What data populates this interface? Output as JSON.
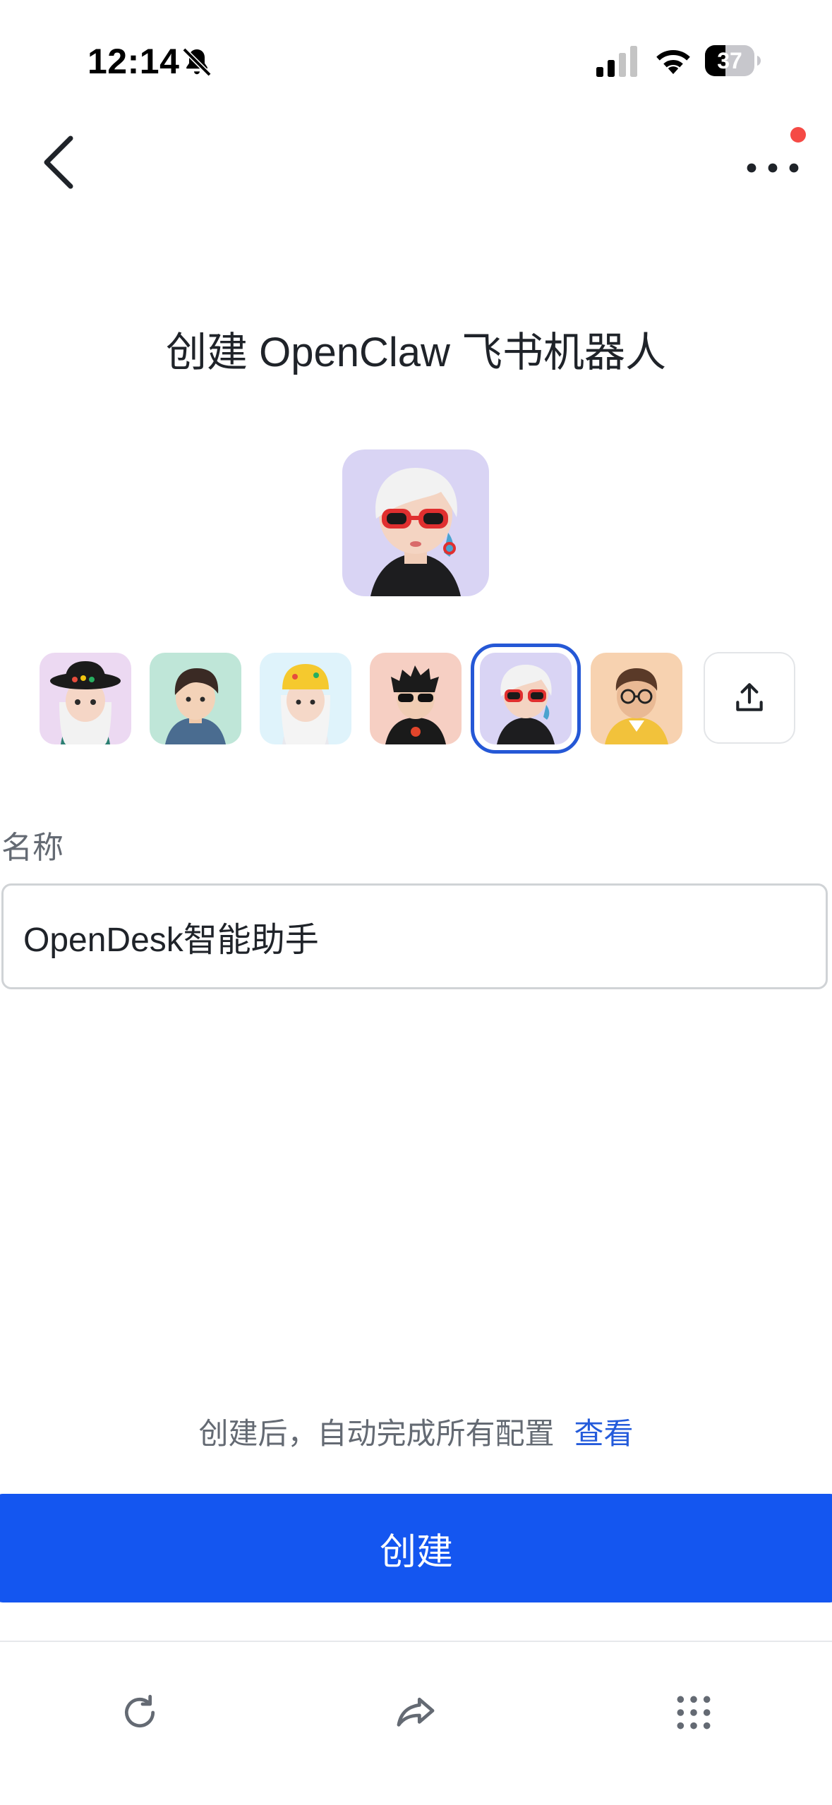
{
  "status_bar": {
    "time": "12:14",
    "battery": "37",
    "icons": [
      "bell-muted-icon",
      "cellular-signal-icon",
      "wifi-icon",
      "battery-icon"
    ]
  },
  "nav": {
    "back_icon": "chevron-left-icon",
    "more_icon": "more-horizontal-icon",
    "notification_dot_color": "#f54a45"
  },
  "page": {
    "title": "创建 OpenClaw 飞书机器人"
  },
  "avatar_picker": {
    "selected_index": 4,
    "options": [
      {
        "name": "avatar-girl-black-hat"
      },
      {
        "name": "avatar-boy-denim"
      },
      {
        "name": "avatar-girl-yellow-beanie"
      },
      {
        "name": "avatar-boy-sunglasses"
      },
      {
        "name": "avatar-girl-red-glasses"
      },
      {
        "name": "avatar-man-glasses"
      }
    ],
    "upload_icon": "upload-icon"
  },
  "form": {
    "name_label": "名称",
    "name_value": "OpenDesk智能助手"
  },
  "footer": {
    "hint": "创建后，自动完成所有配置",
    "hint_link": "查看",
    "create_button": "创建",
    "accent_color": "#1456f0"
  },
  "browser_bar": {
    "icons": [
      "refresh-icon",
      "share-icon",
      "grid-menu-icon"
    ]
  }
}
